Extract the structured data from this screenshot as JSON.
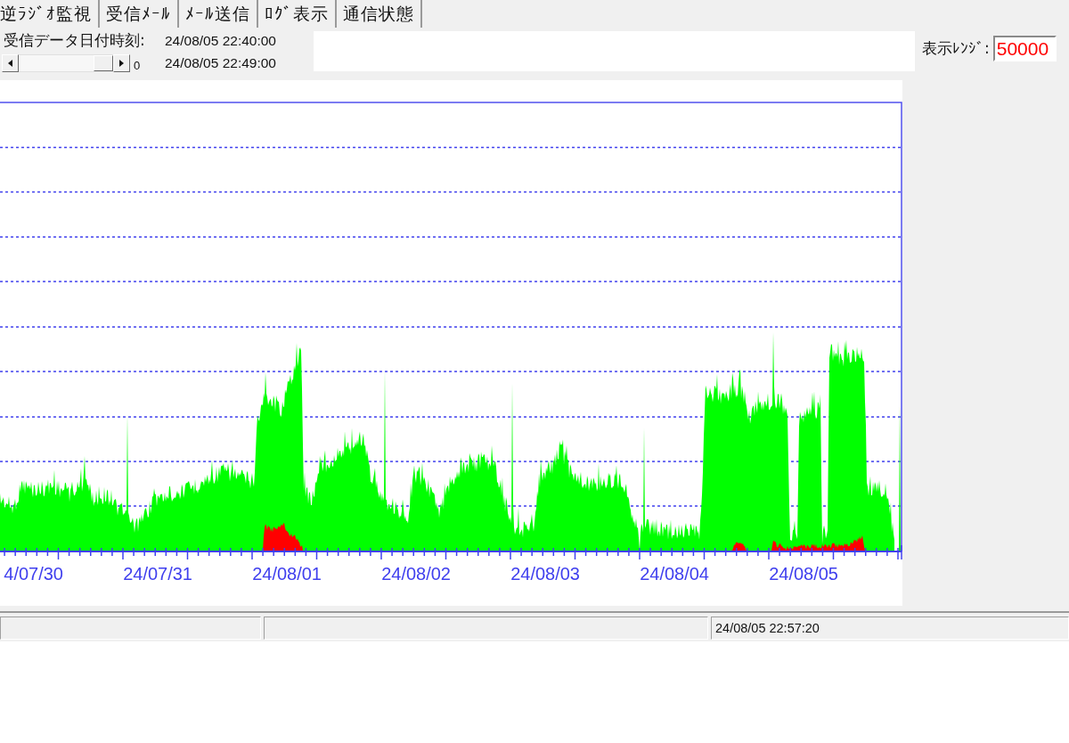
{
  "tabs": [
    {
      "label": "逆ﾗｼﾞｵ監視"
    },
    {
      "label": "受信ﾒｰﾙ"
    },
    {
      "label": "ﾒｰﾙ送信"
    },
    {
      "label": "ﾛｸﾞ表示"
    },
    {
      "label": "通信状態"
    }
  ],
  "data_info": {
    "label": "受信データ日付時刻:",
    "start_time": "24/08/05 22:40:00",
    "end_time": "24/08/05 22:49:00",
    "scroll_value": "0"
  },
  "display_range": {
    "label": "表示ﾚﾝｼﾞ:",
    "value": "50000"
  },
  "chart": {
    "date_labels": [
      "4/07/30",
      "24/07/31",
      "24/08/01",
      "24/08/02",
      "24/08/03",
      "24/08/04",
      "24/08/05"
    ]
  },
  "status_bar": {
    "time": "24/08/05 22:57:20"
  }
}
